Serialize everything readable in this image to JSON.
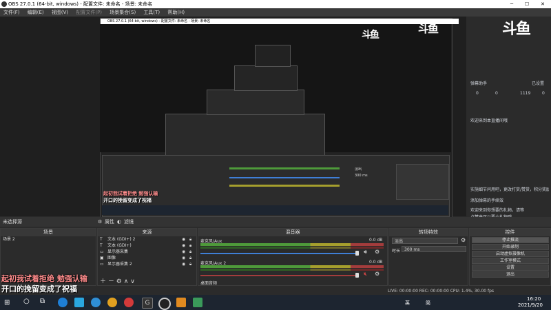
{
  "window": {
    "title": "OBS 27.0.1 (64-bit, windows) - 配置文件: 未命名 - 场景: 未命名"
  },
  "menu": [
    "文件(F)",
    "编辑(E)",
    "视图(V)",
    "配置文件(P)",
    "场景集合(S)",
    "工具(T)",
    "帮助(H)"
  ],
  "brand": {
    "logo_text": "斗鱼"
  },
  "nested": {
    "title": "OBS 27.0.1 (64-bit, windows) - 配置文件: 未命名 - 场景: 未命名",
    "caption_red": "起初我试着拒绝 勉强认输",
    "caption_white": "开口的挽留变成了祝福",
    "transition_value": "淡出",
    "duration_value": "300 ms"
  },
  "chat": {
    "header_left": "弹幕助手",
    "header_right": "已设置",
    "stats": [
      "0",
      "0",
      "1119",
      "0"
    ],
    "line1": "欢迎来到本直播间哦",
    "line2": "实施细节问用吧，更改打赏/赞赏，积分奖励？哈哈",
    "line3": "添加弹幕的手续效",
    "line4": "欢迎来到你想要的礼物，请等",
    "line5": "点赞来可以要小礼物哦"
  },
  "status": {
    "scene_label": "未选择源",
    "filter_label": "属性",
    "props_label": "滤镜"
  },
  "panels": {
    "scenes": {
      "title": "场景",
      "items": [
        "场景 2"
      ]
    },
    "sources": {
      "title": "来源",
      "items": [
        "文本 (GDI+) 2",
        "文本 (GDI+)",
        "显示器采集",
        "图像",
        "显示器采集 2"
      ]
    },
    "mixer": {
      "title": "混音器",
      "track1": {
        "name": "麦克风/Aux",
        "db": "0.0 dB"
      },
      "track2": {
        "name": "麦克风/Aux 2",
        "db": "0.0 dB"
      },
      "track3": {
        "name": "桌面音频",
        "db": "-64.1"
      }
    },
    "transitions": {
      "title": "转场特效",
      "type": "淡出",
      "duration_label": "时长",
      "duration": "300 ms"
    },
    "controls": {
      "title": "控件",
      "buttons": [
        "停止推流",
        "开始录制",
        "启动虚拟摄像机",
        "工作室模式",
        "设置",
        "退出"
      ]
    }
  },
  "captions": {
    "red": "起初我试着拒绝 勉强认输",
    "white": "开口的挽留变成了祝福"
  },
  "statusbar": "LIVE: 00:00:00   REC: 00:00:00   CPU: 1.4%, 30.00 fps",
  "taskbar": {
    "time": "16:20",
    "date": "2021/9/20",
    "ime": "英",
    "ime2": "简"
  }
}
